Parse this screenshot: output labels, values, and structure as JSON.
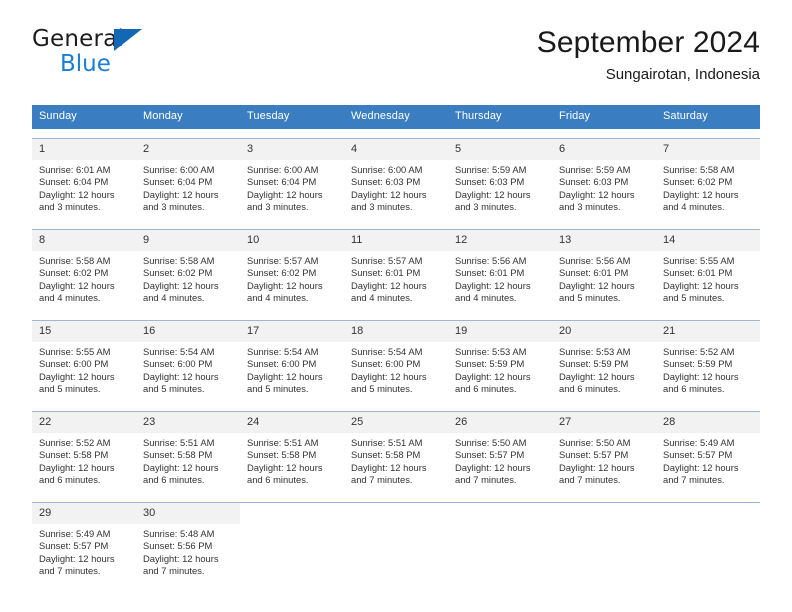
{
  "brand": {
    "line1": "General",
    "line2": "Blue",
    "triangle_color": "#1268b3",
    "line2_color": "#1a7fd4"
  },
  "header": {
    "title": "September 2024",
    "subtitle": "Sungairotan, Indonesia"
  },
  "theme": {
    "header_row_bg": "#3a7dc0",
    "header_row_text": "#ffffff",
    "daynum_bg": "#f2f2f2",
    "cell_text": "#333333",
    "row_divider": "#9fb8d0"
  },
  "weekdays": [
    "Sunday",
    "Monday",
    "Tuesday",
    "Wednesday",
    "Thursday",
    "Friday",
    "Saturday"
  ],
  "weeks": [
    [
      {
        "day": "1",
        "sunrise": "Sunrise: 6:01 AM",
        "sunset": "Sunset: 6:04 PM",
        "daylight1": "Daylight: 12 hours",
        "daylight2": "and 3 minutes."
      },
      {
        "day": "2",
        "sunrise": "Sunrise: 6:00 AM",
        "sunset": "Sunset: 6:04 PM",
        "daylight1": "Daylight: 12 hours",
        "daylight2": "and 3 minutes."
      },
      {
        "day": "3",
        "sunrise": "Sunrise: 6:00 AM",
        "sunset": "Sunset: 6:04 PM",
        "daylight1": "Daylight: 12 hours",
        "daylight2": "and 3 minutes."
      },
      {
        "day": "4",
        "sunrise": "Sunrise: 6:00 AM",
        "sunset": "Sunset: 6:03 PM",
        "daylight1": "Daylight: 12 hours",
        "daylight2": "and 3 minutes."
      },
      {
        "day": "5",
        "sunrise": "Sunrise: 5:59 AM",
        "sunset": "Sunset: 6:03 PM",
        "daylight1": "Daylight: 12 hours",
        "daylight2": "and 3 minutes."
      },
      {
        "day": "6",
        "sunrise": "Sunrise: 5:59 AM",
        "sunset": "Sunset: 6:03 PM",
        "daylight1": "Daylight: 12 hours",
        "daylight2": "and 3 minutes."
      },
      {
        "day": "7",
        "sunrise": "Sunrise: 5:58 AM",
        "sunset": "Sunset: 6:02 PM",
        "daylight1": "Daylight: 12 hours",
        "daylight2": "and 4 minutes."
      }
    ],
    [
      {
        "day": "8",
        "sunrise": "Sunrise: 5:58 AM",
        "sunset": "Sunset: 6:02 PM",
        "daylight1": "Daylight: 12 hours",
        "daylight2": "and 4 minutes."
      },
      {
        "day": "9",
        "sunrise": "Sunrise: 5:58 AM",
        "sunset": "Sunset: 6:02 PM",
        "daylight1": "Daylight: 12 hours",
        "daylight2": "and 4 minutes."
      },
      {
        "day": "10",
        "sunrise": "Sunrise: 5:57 AM",
        "sunset": "Sunset: 6:02 PM",
        "daylight1": "Daylight: 12 hours",
        "daylight2": "and 4 minutes."
      },
      {
        "day": "11",
        "sunrise": "Sunrise: 5:57 AM",
        "sunset": "Sunset: 6:01 PM",
        "daylight1": "Daylight: 12 hours",
        "daylight2": "and 4 minutes."
      },
      {
        "day": "12",
        "sunrise": "Sunrise: 5:56 AM",
        "sunset": "Sunset: 6:01 PM",
        "daylight1": "Daylight: 12 hours",
        "daylight2": "and 4 minutes."
      },
      {
        "day": "13",
        "sunrise": "Sunrise: 5:56 AM",
        "sunset": "Sunset: 6:01 PM",
        "daylight1": "Daylight: 12 hours",
        "daylight2": "and 5 minutes."
      },
      {
        "day": "14",
        "sunrise": "Sunrise: 5:55 AM",
        "sunset": "Sunset: 6:01 PM",
        "daylight1": "Daylight: 12 hours",
        "daylight2": "and 5 minutes."
      }
    ],
    [
      {
        "day": "15",
        "sunrise": "Sunrise: 5:55 AM",
        "sunset": "Sunset: 6:00 PM",
        "daylight1": "Daylight: 12 hours",
        "daylight2": "and 5 minutes."
      },
      {
        "day": "16",
        "sunrise": "Sunrise: 5:54 AM",
        "sunset": "Sunset: 6:00 PM",
        "daylight1": "Daylight: 12 hours",
        "daylight2": "and 5 minutes."
      },
      {
        "day": "17",
        "sunrise": "Sunrise: 5:54 AM",
        "sunset": "Sunset: 6:00 PM",
        "daylight1": "Daylight: 12 hours",
        "daylight2": "and 5 minutes."
      },
      {
        "day": "18",
        "sunrise": "Sunrise: 5:54 AM",
        "sunset": "Sunset: 6:00 PM",
        "daylight1": "Daylight: 12 hours",
        "daylight2": "and 5 minutes."
      },
      {
        "day": "19",
        "sunrise": "Sunrise: 5:53 AM",
        "sunset": "Sunset: 5:59 PM",
        "daylight1": "Daylight: 12 hours",
        "daylight2": "and 6 minutes."
      },
      {
        "day": "20",
        "sunrise": "Sunrise: 5:53 AM",
        "sunset": "Sunset: 5:59 PM",
        "daylight1": "Daylight: 12 hours",
        "daylight2": "and 6 minutes."
      },
      {
        "day": "21",
        "sunrise": "Sunrise: 5:52 AM",
        "sunset": "Sunset: 5:59 PM",
        "daylight1": "Daylight: 12 hours",
        "daylight2": "and 6 minutes."
      }
    ],
    [
      {
        "day": "22",
        "sunrise": "Sunrise: 5:52 AM",
        "sunset": "Sunset: 5:58 PM",
        "daylight1": "Daylight: 12 hours",
        "daylight2": "and 6 minutes."
      },
      {
        "day": "23",
        "sunrise": "Sunrise: 5:51 AM",
        "sunset": "Sunset: 5:58 PM",
        "daylight1": "Daylight: 12 hours",
        "daylight2": "and 6 minutes."
      },
      {
        "day": "24",
        "sunrise": "Sunrise: 5:51 AM",
        "sunset": "Sunset: 5:58 PM",
        "daylight1": "Daylight: 12 hours",
        "daylight2": "and 6 minutes."
      },
      {
        "day": "25",
        "sunrise": "Sunrise: 5:51 AM",
        "sunset": "Sunset: 5:58 PM",
        "daylight1": "Daylight: 12 hours",
        "daylight2": "and 7 minutes."
      },
      {
        "day": "26",
        "sunrise": "Sunrise: 5:50 AM",
        "sunset": "Sunset: 5:57 PM",
        "daylight1": "Daylight: 12 hours",
        "daylight2": "and 7 minutes."
      },
      {
        "day": "27",
        "sunrise": "Sunrise: 5:50 AM",
        "sunset": "Sunset: 5:57 PM",
        "daylight1": "Daylight: 12 hours",
        "daylight2": "and 7 minutes."
      },
      {
        "day": "28",
        "sunrise": "Sunrise: 5:49 AM",
        "sunset": "Sunset: 5:57 PM",
        "daylight1": "Daylight: 12 hours",
        "daylight2": "and 7 minutes."
      }
    ],
    [
      {
        "day": "29",
        "sunrise": "Sunrise: 5:49 AM",
        "sunset": "Sunset: 5:57 PM",
        "daylight1": "Daylight: 12 hours",
        "daylight2": "and 7 minutes."
      },
      {
        "day": "30",
        "sunrise": "Sunrise: 5:48 AM",
        "sunset": "Sunset: 5:56 PM",
        "daylight1": "Daylight: 12 hours",
        "daylight2": "and 7 minutes."
      },
      {
        "day": "",
        "sunrise": "",
        "sunset": "",
        "daylight1": "",
        "daylight2": ""
      },
      {
        "day": "",
        "sunrise": "",
        "sunset": "",
        "daylight1": "",
        "daylight2": ""
      },
      {
        "day": "",
        "sunrise": "",
        "sunset": "",
        "daylight1": "",
        "daylight2": ""
      },
      {
        "day": "",
        "sunrise": "",
        "sunset": "",
        "daylight1": "",
        "daylight2": ""
      },
      {
        "day": "",
        "sunrise": "",
        "sunset": "",
        "daylight1": "",
        "daylight2": ""
      }
    ]
  ]
}
